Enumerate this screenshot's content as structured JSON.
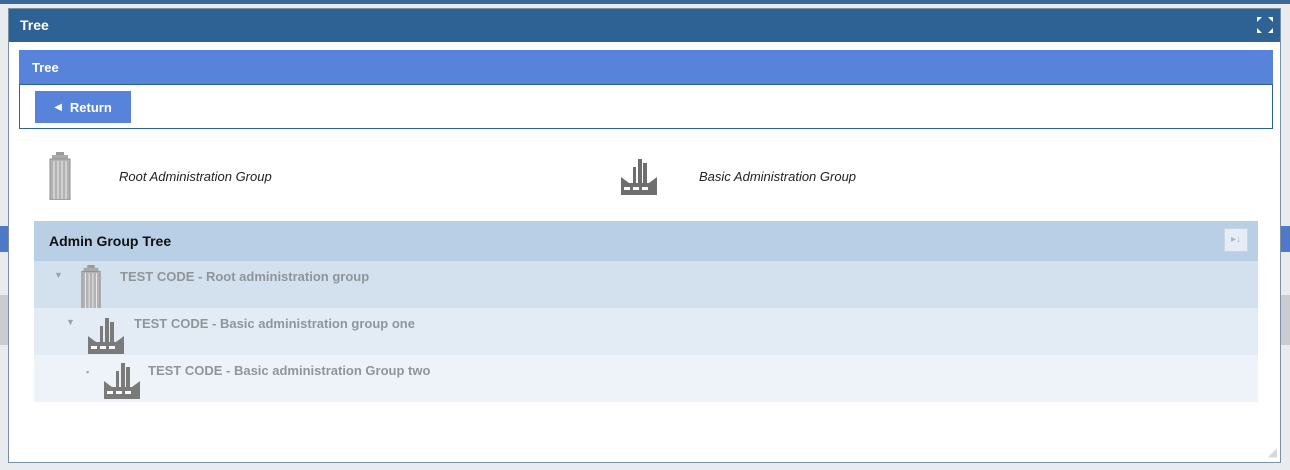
{
  "window": {
    "title": "Tree"
  },
  "panel": {
    "header": "Tree",
    "return_label": "Return"
  },
  "legend": [
    {
      "icon": "root-admin-group-icon",
      "label": "Root Administration Group"
    },
    {
      "icon": "basic-admin-group-icon",
      "label": "Basic Administration Group"
    }
  ],
  "tree": {
    "header": "Admin Group Tree",
    "rows": [
      {
        "label": "TEST CODE -  Root administration group",
        "icon": "root-admin-group-icon",
        "toggle": "expanded"
      },
      {
        "label": "TEST CODE - Basic administration group one",
        "icon": "basic-admin-group-icon",
        "toggle": "expanded"
      },
      {
        "label": "TEST CODE - Basic administration Group two",
        "icon": "basic-admin-group-icon",
        "toggle": "leaf"
      }
    ]
  },
  "colors": {
    "title_bar": "#2f6294",
    "panel_header": "#5883db",
    "tree_header": "#b8cfe6"
  }
}
